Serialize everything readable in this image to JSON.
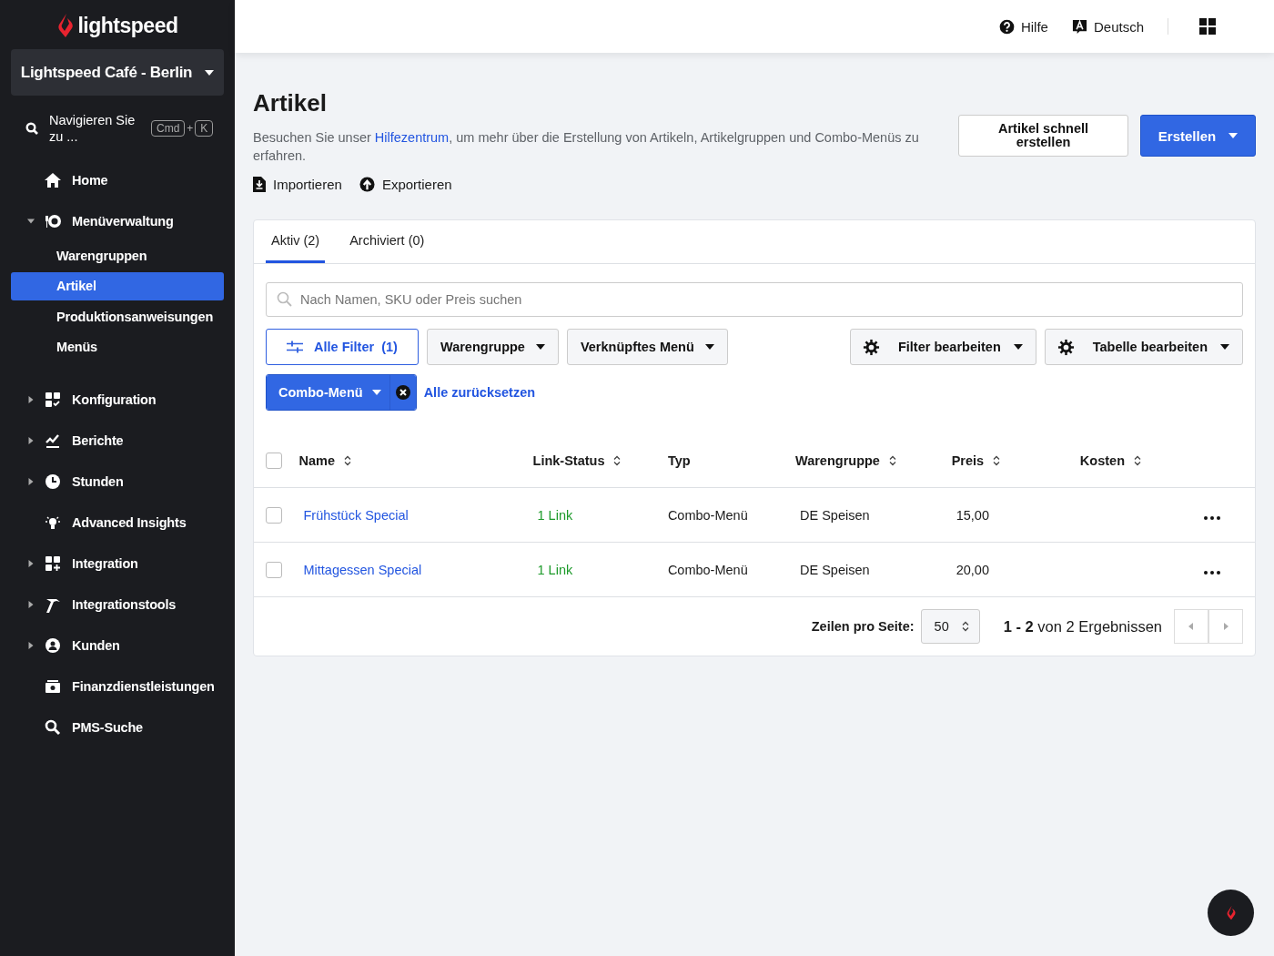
{
  "sidebar": {
    "logo": "lightspeed",
    "location": "Lightspeed Café - Berlin",
    "search": {
      "placeholder": "Navigieren Sie zu ...",
      "keys": [
        "Cmd",
        "+",
        "K"
      ]
    },
    "items": [
      {
        "label": "Home",
        "kind": "link"
      },
      {
        "label": "Menüverwaltung",
        "kind": "group",
        "expanded": true,
        "children": [
          {
            "label": "Warengruppen",
            "selected": false
          },
          {
            "label": "Artikel",
            "selected": true
          },
          {
            "label": "Produktionsanweisungen",
            "selected": false
          },
          {
            "label": "Menüs",
            "selected": false
          }
        ]
      },
      {
        "label": "Konfiguration",
        "kind": "group",
        "expanded": false
      },
      {
        "label": "Berichte",
        "kind": "group",
        "expanded": false
      },
      {
        "label": "Stunden",
        "kind": "group",
        "expanded": false
      },
      {
        "label": "Advanced Insights",
        "kind": "link"
      },
      {
        "label": "Integration",
        "kind": "group",
        "expanded": false
      },
      {
        "label": "Integrationstools",
        "kind": "group",
        "expanded": false
      },
      {
        "label": "Kunden",
        "kind": "group",
        "expanded": false
      },
      {
        "label": "Finanzdienstleistungen",
        "kind": "link"
      },
      {
        "label": "PMS-Suche",
        "kind": "link"
      }
    ]
  },
  "topbar": {
    "help": "Hilfe",
    "language": "Deutsch"
  },
  "page": {
    "title": "Artikel",
    "description": {
      "before": "Besuchen Sie unser ",
      "link": "Hilfezentrum",
      "after": ", um mehr über die Erstellung von Artikeln, Artikelgruppen und Combo-Menüs zu erfahren."
    },
    "actions": [
      "Importieren",
      "Exportieren"
    ],
    "quick_create": "Artikel schnell erstellen",
    "create": "Erstellen"
  },
  "tabs": [
    {
      "label": "Aktiv (2)",
      "selected": true
    },
    {
      "label": "Archiviert (0)",
      "selected": false
    }
  ],
  "search": {
    "placeholder": "Nach Namen, SKU oder Preis suchen"
  },
  "filters": {
    "all_filters": "Alle Filter",
    "count": "(1)",
    "dropdowns": [
      "Warengruppe",
      "Verknüpftes Menü"
    ],
    "edit_filters": "Filter bearbeiten",
    "edit_table": "Tabelle bearbeiten",
    "chips": [
      "Combo-Menü"
    ],
    "reset": "Alle zurücksetzen"
  },
  "table": {
    "all_checked": false,
    "columns": [
      {
        "label": "Name",
        "sortable": true
      },
      {
        "label": "Link-Status",
        "sortable": true
      },
      {
        "label": "Typ",
        "sortable": false
      },
      {
        "label": "Warengruppe",
        "sortable": true
      },
      {
        "label": "Preis",
        "sortable": true
      },
      {
        "label": "Kosten",
        "sortable": true
      }
    ],
    "rows": [
      {
        "checked": false,
        "name": "Frühstück Special",
        "link_status": "1 Link",
        "type": "Combo-Menü",
        "group": "DE Speisen",
        "price": "15,00"
      },
      {
        "checked": false,
        "name": "Mittagessen Special",
        "link_status": "1 Link",
        "type": "Combo-Menü",
        "group": "DE Speisen",
        "price": "20,00"
      }
    ]
  },
  "pagination": {
    "rows_label": "Zeilen pro Seite:",
    "rows_value": "50",
    "range": "1 - 2",
    "total": "von 2 Ergebnissen"
  }
}
